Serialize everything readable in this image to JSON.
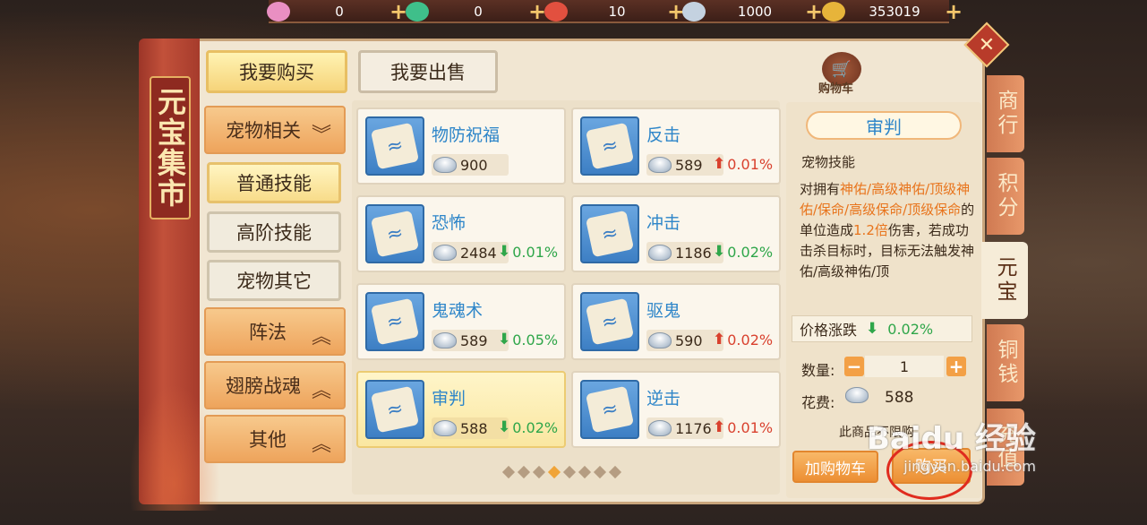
{
  "top_resources": [
    {
      "icon": "pink-spirit-icon",
      "color": "#e98fc2",
      "value": "0"
    },
    {
      "icon": "green-spirit-icon",
      "color": "#3fbf8a",
      "value": "0"
    },
    {
      "icon": "red-spirit-icon",
      "color": "#e2503f",
      "value": "10"
    },
    {
      "icon": "silver-ingot-icon",
      "color": "#c4d2e0",
      "value": "1000"
    },
    {
      "icon": "gold-coin-icon",
      "color": "#e7b43a",
      "value": "353019"
    }
  ],
  "market_title": "元宝集市",
  "tabs": {
    "buy": "我要购买",
    "sell": "我要出售"
  },
  "cart_label": "购物车",
  "categories": {
    "pet": "宠物相关",
    "normal_skill": "普通技能",
    "advanced_skill": "高阶技能",
    "pet_other": "宠物其它",
    "formation": "阵法",
    "wings": "翅膀战魂",
    "other": "其他"
  },
  "items": [
    {
      "name": "物防祝福",
      "price": "900",
      "change": "",
      "dir": ""
    },
    {
      "name": "反击",
      "price": "589",
      "change": "0.01%",
      "dir": "up"
    },
    {
      "name": "恐怖",
      "price": "2484",
      "change": "0.01%",
      "dir": "down"
    },
    {
      "name": "冲击",
      "price": "1186",
      "change": "0.02%",
      "dir": "down"
    },
    {
      "name": "鬼魂术",
      "price": "589",
      "change": "0.05%",
      "dir": "down"
    },
    {
      "name": "驱鬼",
      "price": "590",
      "change": "0.02%",
      "dir": "up"
    },
    {
      "name": "审判",
      "price": "588",
      "change": "0.02%",
      "dir": "down"
    },
    {
      "name": "逆击",
      "price": "1176",
      "change": "0.01%",
      "dir": "up"
    }
  ],
  "pager": {
    "total": 8,
    "current": 4
  },
  "detail": {
    "title": "审判",
    "type": "宠物技能",
    "desc_parts": [
      {
        "t": "对拥有",
        "hl": false
      },
      {
        "t": "神佑/高级神佑/顶级神佑/保命/高级保命/顶级保命",
        "hl": true
      },
      {
        "t": "的单位造成",
        "hl": false
      },
      {
        "t": "1.2倍",
        "hl": true
      },
      {
        "t": "伤害，若成功击杀目标时，目标无法触发神佑/高级神佑/顶",
        "hl": false
      }
    ],
    "trend_label": "价格涨跌",
    "trend_value": "0.02%",
    "qty_label": "数量:",
    "qty_value": "1",
    "cost_label": "花费:",
    "cost_value": "588",
    "unlimited": "此商品不限购",
    "add_cart": "加购物车",
    "buy": "购买"
  },
  "side_tabs": [
    "商行",
    "积分",
    "元宝",
    "铜钱",
    "充值"
  ],
  "watermark": {
    "logo": "Baidu 经验",
    "url": "jingyan.baidu.com"
  }
}
